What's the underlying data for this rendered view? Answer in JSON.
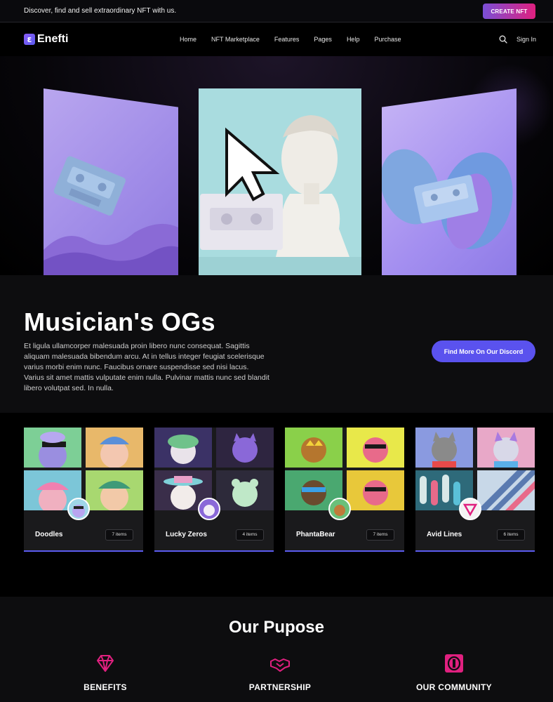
{
  "topbar": {
    "tagline": "Discover, find and sell extraordinary NFT with us.",
    "create_label": "CREATE NFT"
  },
  "nav": {
    "logo_mark": "ɛ",
    "logo_text": "Enefti",
    "items": [
      "Home",
      "NFT Marketplace",
      "Features",
      "Pages",
      "Help",
      "Purchase"
    ],
    "signin": "Sign In",
    "search_icon": "search-icon"
  },
  "og": {
    "heading": "Musician's OGs",
    "description": "Et ligula ullamcorper malesuada proin libero nunc consequat. Sagittis aliquam malesuada bibendum arcu. At in tellus integer feugiat scelerisque varius morbi enim nunc. Faucibus ornare suspendisse sed nisi lacus. Varius sit amet mattis vulputate enim nulla. Pulvinar mattis nunc sed blandit libero volutpat sed. In nulla.",
    "discord_label": "Find More On Our Discord"
  },
  "collections": [
    {
      "name": "Doodles",
      "count": "7 items"
    },
    {
      "name": "Lucky Zeros",
      "count": "4 items"
    },
    {
      "name": "PhantaBear",
      "count": "7 items"
    },
    {
      "name": "Avid Lines",
      "count": "6 items"
    }
  ],
  "purpose": {
    "title": "Our Pupose",
    "columns": [
      {
        "label": "BENEFITS",
        "icon": "diamond-icon"
      },
      {
        "label": "PARTNERSHIP",
        "icon": "handshake-icon"
      },
      {
        "label": "OUR COMMUNITY",
        "icon": "community-coin-icon"
      }
    ]
  },
  "colors": {
    "accent": "#5b5cf0",
    "brand_gradient_start": "#7a4fd6",
    "brand_gradient_end": "#e0207f",
    "icon_pink": "#e0207f"
  }
}
